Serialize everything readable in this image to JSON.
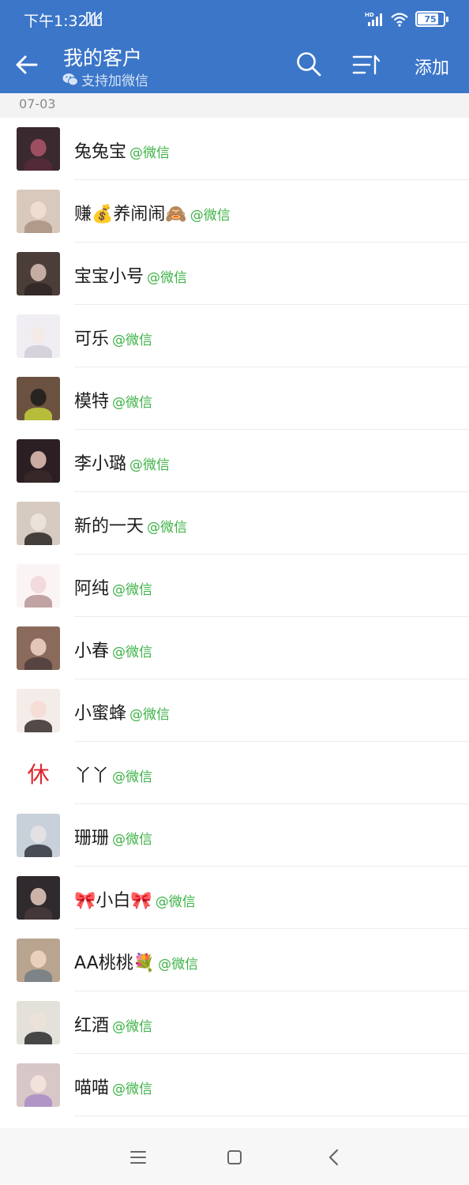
{
  "status_bar": {
    "time": "下午1:32",
    "battery": "75",
    "battery_level": 0.75,
    "icons": [
      "signal-stripes-icon",
      "hd-signal-icon",
      "wifi-icon",
      "battery-icon"
    ]
  },
  "header": {
    "title": "我的客户",
    "subtitle": "支持加微信",
    "add_label": "添加",
    "background": "#3b76c9",
    "icons": [
      "back-arrow-icon",
      "wechat-icon",
      "search-icon",
      "sort-icon"
    ]
  },
  "list": {
    "date": "07-03",
    "tag_color": "#3cb246",
    "contacts": [
      {
        "name": "兔兔宝",
        "tag": "@微信"
      },
      {
        "name": "赚💰养闹闹🙈",
        "tag": "@微信"
      },
      {
        "name": "宝宝小号",
        "tag": "@微信"
      },
      {
        "name": "可乐",
        "tag": "@微信"
      },
      {
        "name": "模特",
        "tag": "@微信"
      },
      {
        "name": "李小璐",
        "tag": "@微信"
      },
      {
        "name": "新的一天",
        "tag": "@微信"
      },
      {
        "name": "阿纯",
        "tag": "@微信"
      },
      {
        "name": "小春",
        "tag": "@微信"
      },
      {
        "name": "小蜜蜂",
        "tag": "@微信"
      },
      {
        "name": "丫丫",
        "tag": "@微信",
        "avatar_text": "休"
      },
      {
        "name": "珊珊",
        "tag": "@微信"
      },
      {
        "name": "🎀小白🎀",
        "tag": "@微信"
      },
      {
        "name": "AA桃桃💐",
        "tag": "@微信"
      },
      {
        "name": "红酒",
        "tag": "@微信"
      },
      {
        "name": "喵喵",
        "tag": "@微信"
      }
    ]
  },
  "nav_bar": {
    "icons": [
      "menu-icon",
      "home-icon",
      "back-icon"
    ]
  }
}
